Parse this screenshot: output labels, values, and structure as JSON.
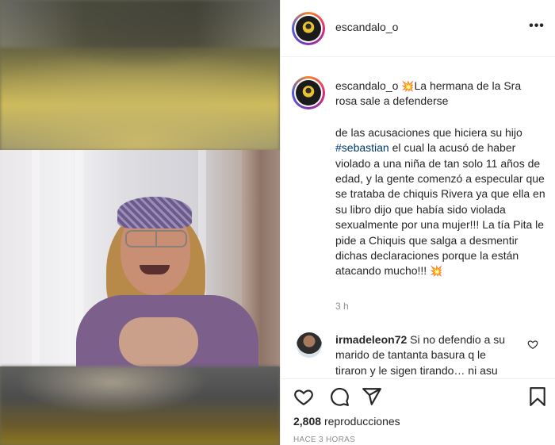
{
  "post": {
    "username": "escandalo_o",
    "more_label": "•••"
  },
  "caption": {
    "username": "escandalo_o",
    "emoji_start": "💥",
    "line1": "La hermana de la Sra rosa sale a defenderse",
    "text_before_hashtag": "de las acusaciones que hiciera su hijo ",
    "hashtag": "#sebastian",
    "text_after_hashtag": " el cual la acusó de haber violado a una niña de tan solo 11 años de edad, y la gente comenzó a especular que se trataba de chiquis Rivera ya que ella en su libro dijo que había sido violada sexualmente por una mujer!!! La tía Pita le pide a Chiquis que salga a desmentir dichas declaraciones porque la están atacando mucho!!! ",
    "emoji_end": "💥",
    "time_ago": "3 h"
  },
  "comment": {
    "username": "irmadeleon72",
    "text": "Si no defendio a su marido de tantanta basura q le tiraron y le sigen tirando… ni asu"
  },
  "actions": {
    "views_count": "2,808",
    "views_label": "reproducciones",
    "posted": "HACE 3 HORAS"
  },
  "icons": [
    "heart-icon",
    "comment-icon",
    "share-icon",
    "bookmark-icon",
    "more-icon",
    "heart-outline-icon"
  ],
  "colors": {
    "text": "#262626",
    "muted": "#8e8e8e",
    "hashtag": "#00376b",
    "border": "#efefef",
    "emoji_red": "#e0342a"
  }
}
